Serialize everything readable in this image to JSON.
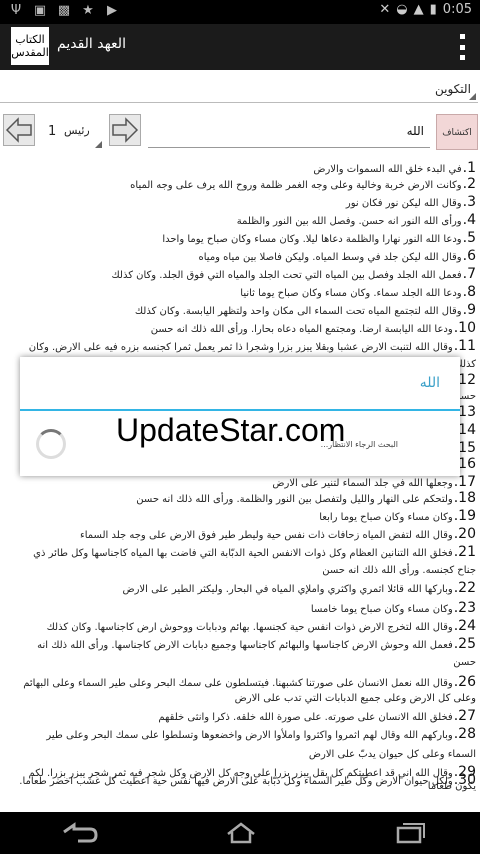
{
  "status": {
    "icons": [
      "usb-icon",
      "gallery-icon",
      "image-icon",
      "star-icon",
      "play-store-icon"
    ],
    "right_icons": [
      "mute-icon",
      "wifi-icon",
      "signal-icon",
      "battery-icon"
    ],
    "time": "0:05"
  },
  "app": {
    "icon_text_line1": "الكتاب",
    "icon_text_line2": "المقدس",
    "title": "العهد القديم"
  },
  "book_select": {
    "value": "التكوين"
  },
  "nav": {
    "chapter_number": "1",
    "chapter_label": "رئيس",
    "search_value": "الله",
    "search_button": "اكتشاف"
  },
  "verses": [
    {
      "n": "1.",
      "text": "في البدء خلق الله السموات والارض"
    },
    {
      "n": "2.",
      "text": "وكانت الارض خربة وخالية وعلى وجه الغمر ظلمة وروح الله يرف على وجه المياه"
    },
    {
      "n": "3.",
      "text": "وقال الله ليكن نور فكان نور"
    },
    {
      "n": "4.",
      "text": "ورأى الله النور انه حسن. وفصل الله بين النور والظلمة"
    },
    {
      "n": "5.",
      "text": "ودعا الله النور نهارا والظلمة دعاها ليلا. وكان مساء وكان صباح يوما واحدا"
    },
    {
      "n": "6.",
      "text": "وقال الله ليكن جلد في وسط المياه. وليكن فاصلا بين مياه ومياه"
    },
    {
      "n": "7.",
      "text": "فعمل الله الجلد وفصل بين المياه التي تحت الجلد والمياه التي فوق الجلد. وكان كذلك"
    },
    {
      "n": "8.",
      "text": "ودعا الله الجلد سماء. وكان مساء وكان صباح يوما ثانيا"
    },
    {
      "n": "9.",
      "text": "وقال الله لتجتمع المياه تحت السماء الى مكان واحد ولتظهر اليابسة. وكان كذلك"
    },
    {
      "n": "10.",
      "text": "ودعا الله اليابسة ارضا. ومجتمع المياه دعاه بحارا. ورأى الله ذلك انه حسن"
    },
    {
      "n": "11.",
      "text": "وقال الله لتنبت الارض عشبا وبقلا يبزر بزرا وشجرا ذا ثمر يعمل ثمرا كجنسه بزره فيه على الارض. وكان"
    },
    {
      "n": "",
      "text": "كذلك"
    },
    {
      "n": "12",
      "text": ""
    },
    {
      "n": "",
      "text": "حسن"
    },
    {
      "n": "13",
      "text": ""
    },
    {
      "n": "14",
      "text": ""
    },
    {
      "n": "15",
      "text": ""
    },
    {
      "n": "16",
      "text": ""
    },
    {
      "n": "17.",
      "text": "وجعلها الله في جلد السماء لتنير على الارض"
    },
    {
      "n": "18.",
      "text": "ولتحكم على النهار والليل ولتفصل بين النور والظلمة. ورأى الله ذلك انه حسن"
    },
    {
      "n": "19.",
      "text": "وكان مساء وكان صباح يوما رابعا"
    },
    {
      "n": "20.",
      "text": "وقال الله لتفض المياه زحافات ذات نفس حية وليطر طير فوق الارض على وجه جلد السماء"
    },
    {
      "n": "21.",
      "text": "فخلق الله التنانين العظام وكل ذوات الانفس الحية الدبّابة التي فاضت بها المياه كاجناسها وكل طائر ذي"
    },
    {
      "n": "",
      "text": "جناح كجنسه. ورأى الله ذلك انه حسن"
    },
    {
      "n": "22.",
      "text": "وباركها الله قائلا اثمري واكثري واملإي المياه في البحار. وليكثر الطير على الارض"
    },
    {
      "n": "23.",
      "text": "وكان مساء وكان صباح يوما خامسا"
    },
    {
      "n": "24.",
      "text": "وقال الله لتخرج الارض ذوات انفس حية كجنسها. بهائم ودبابات ووحوش ارض كاجناسها. وكان كذلك"
    },
    {
      "n": "25.",
      "text": "فعمل الله وحوش الارض كاجناسها والبهائم كاجناسها وجميع دبابات الارض كاجناسها. ورأى الله ذلك انه"
    },
    {
      "n": "",
      "text": "حسن"
    },
    {
      "n": "26.",
      "text": "وقال الله نعمل الانسان على صورتنا كشبهنا. فيتسلطون على سمك البحر وعلى طير السماء وعلى البهائم"
    },
    {
      "n": "",
      "text": "وعلى كل الارض وعلى جميع الدبابات التي تدب على الارض"
    },
    {
      "n": "27.",
      "text": "فخلق الله الانسان على صورته. على صورة الله خلقه. ذكرا وانثى خلقهم"
    },
    {
      "n": "28.",
      "text": "وباركهم الله وقال لهم اثمروا واكثروا واملأوا الارض واخضعوها وتسلطوا على سمك البحر وعلى طير"
    },
    {
      "n": "",
      "text": "السماء وعلى كل حيوان يدبّ على الارض"
    },
    {
      "n": "29.",
      "text": "وقال الله اني قد اعطيتكم كل بقل يبزر بزرا على وجه كل الارض وكل شجر فيه ثمر شجر يبزر بزرا. لكم"
    },
    {
      "n": "",
      "text": "يكون طعاما"
    },
    {
      "n": "30.",
      "text": "ولكل حيوان الارض وكل طير السماء وكل دبّابة على الارض فيها نفس حية اعطيت كل عشب اخضر طعاما."
    }
  ],
  "dialog": {
    "title": "الله",
    "message": "البحث الرجاء الانتظار..."
  },
  "watermark": "UpdateStar.com"
}
